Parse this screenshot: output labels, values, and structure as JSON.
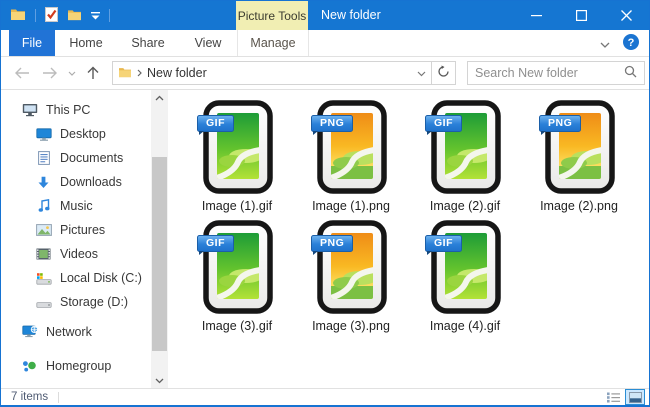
{
  "titlebar": {
    "title": "New folder",
    "contextual_tab_label": "Picture Tools"
  },
  "ribbon": {
    "tabs": [
      {
        "label": "File",
        "active": true
      },
      {
        "label": "Home"
      },
      {
        "label": "Share"
      },
      {
        "label": "View"
      },
      {
        "label": "Manage",
        "contextual": true
      }
    ]
  },
  "navbar": {
    "address_location": "New folder",
    "search_placeholder": "Search New folder"
  },
  "sidebar": {
    "items": [
      {
        "label": "This PC",
        "icon": "this-pc-icon",
        "level": 0
      },
      {
        "label": "Desktop",
        "icon": "desktop-icon",
        "level": 1
      },
      {
        "label": "Documents",
        "icon": "documents-icon",
        "level": 1
      },
      {
        "label": "Downloads",
        "icon": "downloads-icon",
        "level": 1
      },
      {
        "label": "Music",
        "icon": "music-icon",
        "level": 1
      },
      {
        "label": "Pictures",
        "icon": "pictures-icon",
        "level": 1
      },
      {
        "label": "Videos",
        "icon": "videos-icon",
        "level": 1
      },
      {
        "label": "Local Disk (C:)",
        "icon": "local-disk-icon",
        "level": 1
      },
      {
        "label": "Storage (D:)",
        "icon": "storage-disk-icon",
        "level": 1
      },
      {
        "label": "Network",
        "icon": "network-icon",
        "level": 0
      },
      {
        "label": "Homegroup",
        "icon": "homegroup-icon",
        "level": 0
      }
    ]
  },
  "files": [
    {
      "name": "Image (1).gif",
      "type": "GIF"
    },
    {
      "name": "Image (1).png",
      "type": "PNG"
    },
    {
      "name": "Image (2).gif",
      "type": "GIF"
    },
    {
      "name": "Image (2).png",
      "type": "PNG"
    },
    {
      "name": "Image (3).gif",
      "type": "GIF"
    },
    {
      "name": "Image (3).png",
      "type": "PNG"
    },
    {
      "name": "Image (4).gif",
      "type": "GIF"
    }
  ],
  "statusbar": {
    "item_count": "7 items"
  },
  "colors": {
    "titlebar_blue": "#1576d2",
    "file_tab_blue": "#2173d6",
    "contextual_tab_yellow": "#f1eeb3",
    "badge_blue": "#2a80d8",
    "active_view_bg": "#cbe8ff"
  }
}
